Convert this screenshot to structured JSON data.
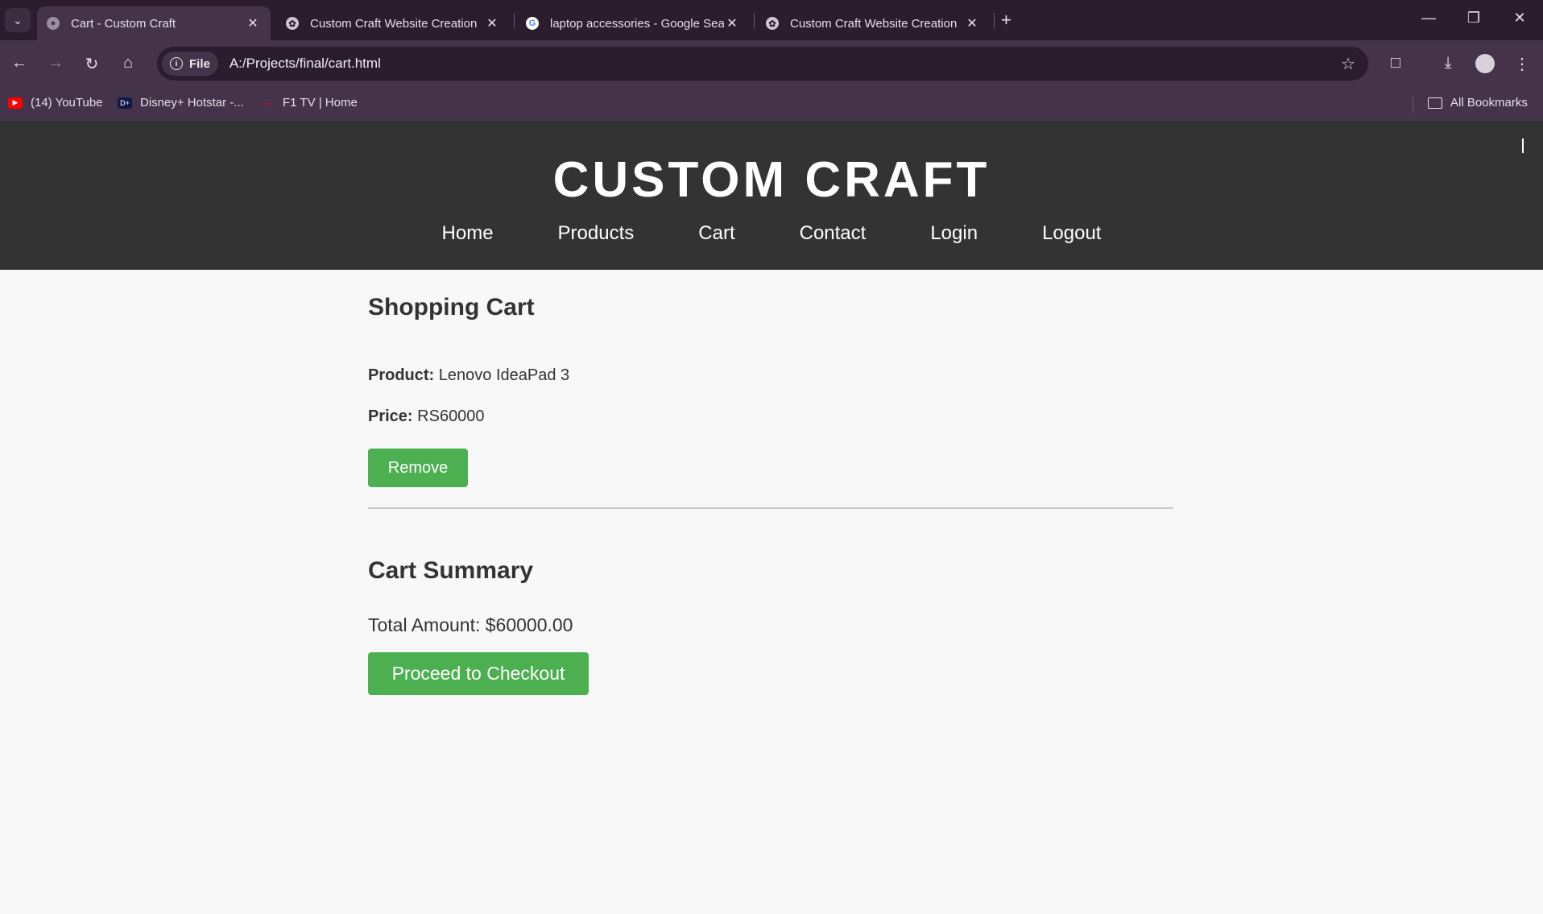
{
  "browser": {
    "tabs": [
      {
        "title": "Cart - Custom Craft",
        "active": true,
        "icon": "globe-icon"
      },
      {
        "title": "Custom Craft Website Creation",
        "active": false,
        "icon": "chatgpt-icon"
      },
      {
        "title": "laptop accessories - Google Sea",
        "active": false,
        "icon": "google-icon"
      },
      {
        "title": "Custom Craft Website Creation",
        "active": false,
        "icon": "chatgpt-icon"
      }
    ],
    "file_chip": "File",
    "url": "A:/Projects/final/cart.html",
    "bookmarks": [
      {
        "label": "(14) YouTube",
        "icon": "youtube-icon",
        "color": "#ff0000"
      },
      {
        "label": "Disney+ Hotstar -...",
        "icon": "hotstar-icon",
        "color": "#0f1a4a"
      },
      {
        "label": "F1 TV | Home",
        "icon": "f1-icon",
        "color": "#e10600"
      }
    ],
    "all_bookmarks": "All Bookmarks"
  },
  "site": {
    "title": "CUSTOM CRAFT",
    "nav": [
      "Home",
      "Products",
      "Cart",
      "Contact",
      "Login",
      "Logout"
    ]
  },
  "cart": {
    "heading": "Shopping Cart",
    "product_label": "Product:",
    "product_value": "Lenovo IdeaPad 3",
    "price_label": "Price:",
    "price_value": "RS60000",
    "remove_label": "Remove"
  },
  "summary": {
    "heading": "Cart Summary",
    "total": "Total Amount: $60000.00",
    "checkout_label": "Proceed to Checkout"
  },
  "colors": {
    "accent": "#4caf50",
    "header_bg": "#333333",
    "page_bg": "#f8f8f8"
  }
}
